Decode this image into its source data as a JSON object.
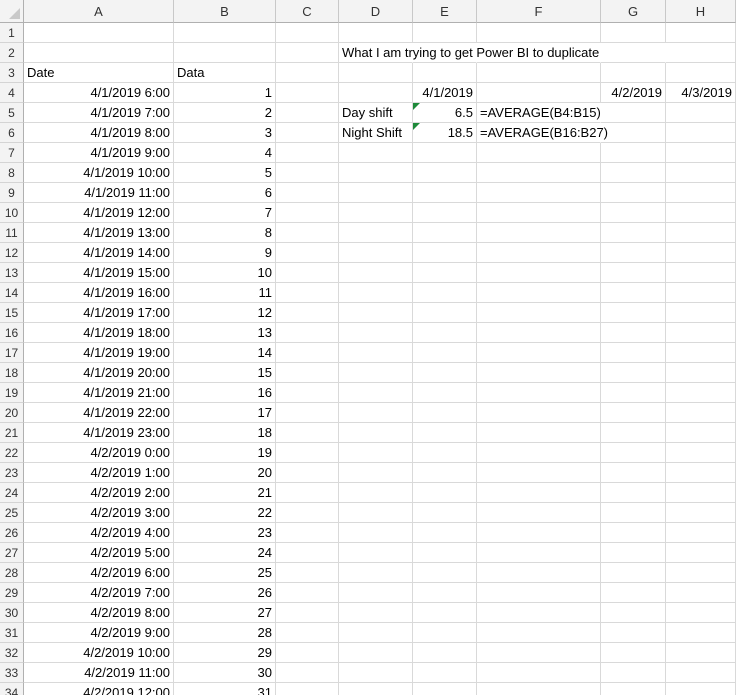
{
  "columns": [
    "A",
    "B",
    "C",
    "D",
    "E",
    "F",
    "G",
    "H"
  ],
  "rows": [
    {
      "n": "1"
    },
    {
      "n": "2",
      "D": "What I am trying to get Power BI to duplicate"
    },
    {
      "n": "3",
      "A": "Date",
      "B": "Data"
    },
    {
      "n": "4",
      "A": "4/1/2019 6:00",
      "B": "1",
      "E": "4/1/2019",
      "G": "4/2/2019",
      "H": "4/3/2019"
    },
    {
      "n": "5",
      "A": "4/1/2019 7:00",
      "B": "2",
      "D": "Day shift",
      "E": "6.5",
      "F": "=AVERAGE(B4:B15)"
    },
    {
      "n": "6",
      "A": "4/1/2019 8:00",
      "B": "3",
      "D": "Night Shift",
      "E": "18.5",
      "F": "=AVERAGE(B16:B27)"
    },
    {
      "n": "7",
      "A": "4/1/2019 9:00",
      "B": "4"
    },
    {
      "n": "8",
      "A": "4/1/2019 10:00",
      "B": "5"
    },
    {
      "n": "9",
      "A": "4/1/2019 11:00",
      "B": "6"
    },
    {
      "n": "10",
      "A": "4/1/2019 12:00",
      "B": "7"
    },
    {
      "n": "11",
      "A": "4/1/2019 13:00",
      "B": "8"
    },
    {
      "n": "12",
      "A": "4/1/2019 14:00",
      "B": "9"
    },
    {
      "n": "13",
      "A": "4/1/2019 15:00",
      "B": "10"
    },
    {
      "n": "14",
      "A": "4/1/2019 16:00",
      "B": "11"
    },
    {
      "n": "15",
      "A": "4/1/2019 17:00",
      "B": "12"
    },
    {
      "n": "16",
      "A": "4/1/2019 18:00",
      "B": "13"
    },
    {
      "n": "17",
      "A": "4/1/2019 19:00",
      "B": "14"
    },
    {
      "n": "18",
      "A": "4/1/2019 20:00",
      "B": "15"
    },
    {
      "n": "19",
      "A": "4/1/2019 21:00",
      "B": "16"
    },
    {
      "n": "20",
      "A": "4/1/2019 22:00",
      "B": "17"
    },
    {
      "n": "21",
      "A": "4/1/2019 23:00",
      "B": "18"
    },
    {
      "n": "22",
      "A": "4/2/2019 0:00",
      "B": "19"
    },
    {
      "n": "23",
      "A": "4/2/2019 1:00",
      "B": "20"
    },
    {
      "n": "24",
      "A": "4/2/2019 2:00",
      "B": "21"
    },
    {
      "n": "25",
      "A": "4/2/2019 3:00",
      "B": "22"
    },
    {
      "n": "26",
      "A": "4/2/2019 4:00",
      "B": "23"
    },
    {
      "n": "27",
      "A": "4/2/2019 5:00",
      "B": "24"
    },
    {
      "n": "28",
      "A": "4/2/2019 6:00",
      "B": "25"
    },
    {
      "n": "29",
      "A": "4/2/2019 7:00",
      "B": "26"
    },
    {
      "n": "30",
      "A": "4/2/2019 8:00",
      "B": "27"
    },
    {
      "n": "31",
      "A": "4/2/2019 9:00",
      "B": "28"
    },
    {
      "n": "32",
      "A": "4/2/2019 10:00",
      "B": "29"
    },
    {
      "n": "33",
      "A": "4/2/2019 11:00",
      "B": "30"
    },
    {
      "n": "34",
      "A": "4/2/2019 12:00",
      "B": "31"
    }
  ],
  "colors": {
    "header_bg": "#f3f3f3",
    "gridline": "#d9d9d9",
    "error_flag": "#1e8a3a"
  }
}
